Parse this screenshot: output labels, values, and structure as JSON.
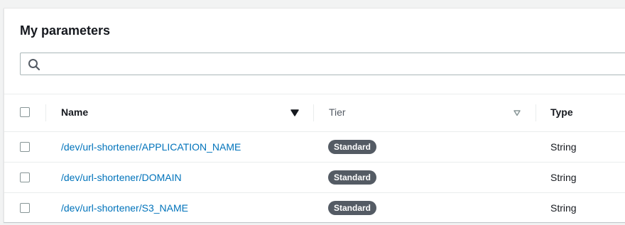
{
  "panel": {
    "title": "My parameters"
  },
  "search": {
    "placeholder": "",
    "value": ""
  },
  "table": {
    "columns": {
      "name": "Name",
      "tier": "Tier",
      "type": "Type"
    },
    "rows": [
      {
        "name": "/dev/url-shortener/APPLICATION_NAME",
        "tier": "Standard",
        "type": "String"
      },
      {
        "name": "/dev/url-shortener/DOMAIN",
        "tier": "Standard",
        "type": "String"
      },
      {
        "name": "/dev/url-shortener/S3_NAME",
        "tier": "Standard",
        "type": "String"
      }
    ]
  },
  "colors": {
    "link": "#0073bb",
    "badge": "#545b64",
    "border": "#eaeded"
  },
  "icons": {
    "search": "search-icon",
    "sort_active": "sort-down-filled-icon",
    "sort_inactive": "sort-down-outline-icon"
  }
}
